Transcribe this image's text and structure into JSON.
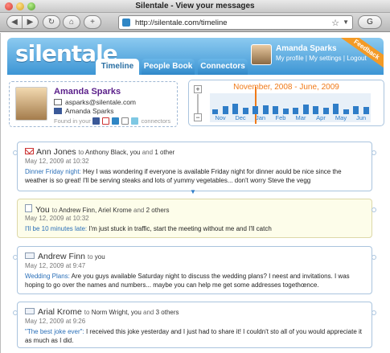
{
  "window": {
    "title": "Silentale - View your messages"
  },
  "browser": {
    "url": "http://silentale.com/timeline",
    "nav_back": "◀",
    "nav_forward": "▶",
    "reload": "↻",
    "home": "⌂",
    "add": "+",
    "star": "☆",
    "search_btn": "G"
  },
  "header": {
    "logo": "silentale",
    "tabs": [
      {
        "label": "Timeline",
        "active": true
      },
      {
        "label": "People Book",
        "active": false
      },
      {
        "label": "Connectors",
        "active": false
      }
    ],
    "user": {
      "name": "Amanda Sparks",
      "links": [
        "My profile",
        "My settings",
        "Logout"
      ]
    },
    "feedback": "Feedback"
  },
  "profile": {
    "name": "Amanda Sparks",
    "email": "asparks@silentale.com",
    "facebook": "Amanda Sparks",
    "found_in": "Found in your",
    "found_suffix": "connectors"
  },
  "timeline": {
    "range": "November, 2008 - June, 2009",
    "months": [
      "Nov",
      "Dec",
      "Jan",
      "Feb",
      "Mar",
      "Apr",
      "May",
      "Jun"
    ],
    "activity": [
      0.4,
      0.7,
      0.9,
      0.6,
      0.7,
      0.8,
      0.7,
      0.5,
      0.6,
      0.85,
      0.7,
      0.55,
      0.9,
      0.45,
      0.7,
      0.65
    ]
  },
  "feed": [
    {
      "source": "gmail",
      "from": "Ann Jones",
      "to_prefix": "to",
      "to": "Anthony Black, you",
      "and": "and",
      "others": "1 other",
      "date": "May 12, 2009 at 10:32",
      "subject": "Dinner Friday night:",
      "body": "Hey I was wondering if everyone is available Friday night for dinner aould be nice since the weather is so great! I'll be serving steaks and lots of yummy vegetables... don't worry Steve the vegg",
      "own": false
    },
    {
      "source": "note",
      "from": "You",
      "to_prefix": "to",
      "to": "Andrew Finn, Ariel Krome",
      "and": "and",
      "others": "2 others",
      "date": "May 12, 2009 at 10:32",
      "subject": "I'll be 10 minutes late:",
      "body": "I'm just stuck in traffic, start the meeting without me and I'll catch",
      "own": true
    },
    {
      "source": "mail",
      "from": "Andrew Finn",
      "to_prefix": "to",
      "to": "you",
      "and": "",
      "others": "",
      "date": "May 12, 2009 at 9:47",
      "subject": "Wedding Plans:",
      "body": "Are you guys available Saturday night to discuss the wedding plans? I neest and invitations. I was hoping to go over the names and numbers... maybe you can help me get some addresses togethœnce.",
      "own": false
    },
    {
      "source": "mail",
      "from": "Arial Krome",
      "to_prefix": "to",
      "to": "Norm Wright, you",
      "and": "and",
      "others": "3 others",
      "date": "May 12, 2009 at 9:26",
      "subject": "\"The best joke ever\":",
      "body": "I received this joke yesterday and I just had to share it! I couldn't sto all of you would appreciate it as much as I did.",
      "own": false
    }
  ],
  "colors": {
    "brand_blue": "#3c95d4",
    "accent_orange": "#f07a18",
    "link_blue": "#2a6fb8"
  }
}
